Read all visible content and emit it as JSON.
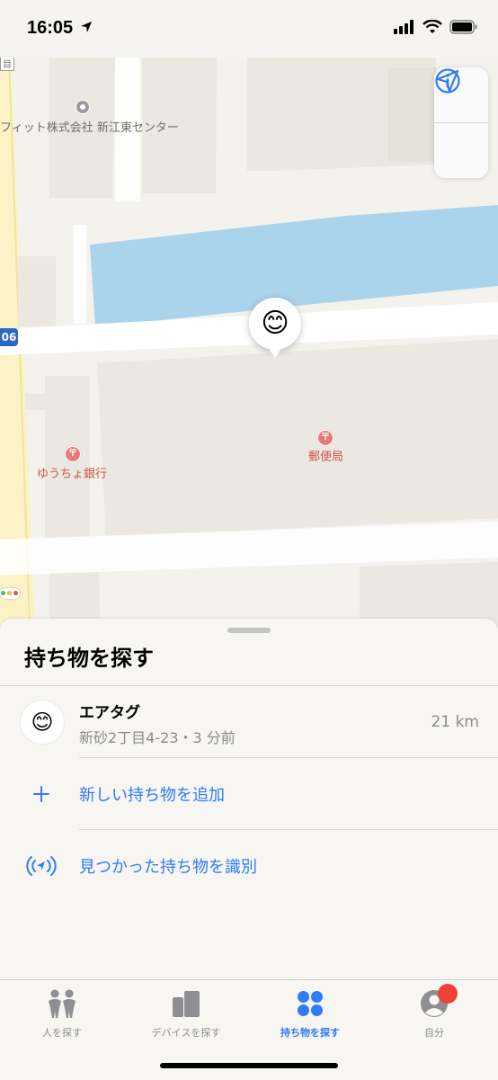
{
  "status_bar": {
    "time": "16:05"
  },
  "map": {
    "labels": {
      "company": "フィット株式会社 新江東センター",
      "bank": "ゆうちょ銀行",
      "post_office": "郵便局",
      "route": "06",
      "top_edge": "目"
    },
    "pin_emoji": "😊",
    "water_color": "#a9d4ec",
    "controls": [
      "info-icon",
      "location-arrow-icon"
    ]
  },
  "sheet": {
    "title": "持ち物を探す",
    "items": [
      {
        "emoji": "😊",
        "name": "エアタグ",
        "subtitle": "新砂2丁目4-23・3 分前",
        "distance": "21 km"
      }
    ],
    "actions": [
      {
        "icon": "plus-icon",
        "label": "新しい持ち物を追加"
      },
      {
        "icon": "nfc-locate-icon",
        "label": "見つかった持ち物を識別"
      }
    ]
  },
  "tabbar": {
    "tabs": [
      {
        "icon": "people-icon",
        "label": "人を探す",
        "active": false
      },
      {
        "icon": "devices-icon",
        "label": "デバイスを探す",
        "active": false
      },
      {
        "icon": "items-icon",
        "label": "持ち物を探す",
        "active": true
      },
      {
        "icon": "me-icon",
        "label": "自分",
        "active": false
      }
    ]
  },
  "colors": {
    "accent": "#2f7cf6",
    "badge": "#f04134",
    "poi_red": "#d2544c"
  }
}
